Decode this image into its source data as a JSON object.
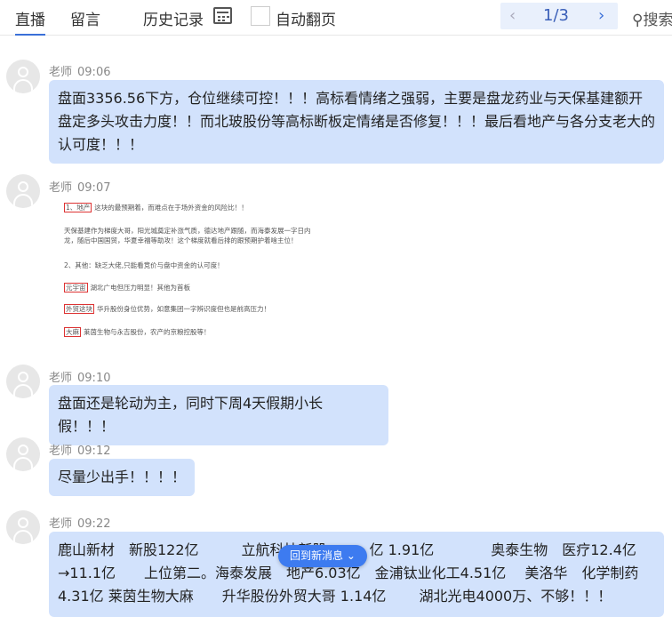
{
  "header": {
    "tabs": [
      "直播",
      "留言"
    ],
    "history": "历史记录",
    "auto_page": "自动翻页",
    "pager": {
      "prev": "‹",
      "current": "1/3",
      "next": "›"
    },
    "search": "搜索"
  },
  "messages": [
    {
      "name": "老师",
      "time": "09:06",
      "text": "盘面3356.56下方，仓位继续可控！！！高标看情绪之强弱，主要是盘龙药业与天保基建额开盘定多头攻击力度！！而北玻股份等高标断板定情绪是否修复！！！最后看地产与各分支老大的认可度！！！"
    },
    {
      "name": "老师",
      "time": "09:07",
      "image": {
        "lines": [
          {
            "tag": "1、地产",
            "text": "这块的最预期着，而难点在于场外资金的风险比！！"
          },
          {
            "tag": "",
            "text": "天保基建作为梯度大哥，阳光城奠定补涨气质，德达地产跟随，而海泰发展一字日内"
          },
          {
            "tag": "",
            "text": "龙，随后中国国贸，华夏幸福等助攻！这个梯度就看后排的跟预期护着啥主位！"
          },
          {
            "tag": "",
            "text": "2、其他：缺乏大佬,只能看竞价与盘中资金的认可度！"
          },
          {
            "tag": "元宇宙",
            "text": "湖北广电但压力明显！其他为首板"
          },
          {
            "tag": "外贸这块",
            "text": "华升股份身位优势，如意集团一字辨识度但也是前高压力！"
          },
          {
            "tag": "大麻",
            "text": "莱茵生物与永吉股份，农产的京粮控股等！"
          }
        ]
      }
    },
    {
      "name": "老师",
      "time": "09:10",
      "text": "盘面还是轮动为主，同时下周4天假期小长假！！！"
    },
    {
      "name": "老师",
      "time": "09:12",
      "text": "尽量少出手！！！！"
    },
    {
      "name": "老师",
      "time": "09:22",
      "text": "鹿山新材　新股122亿　　　立航科技新股　　　亿 1.91亿　　　　奥泰生物　医疗12.4亿→11.1亿　　上位第二。海泰发展　地产6.03亿　金浦钛业化工4.51亿　 美洛华　化学制药　 4.31亿 莱茵生物大麻　　升华股份外贸大哥 1.14亿　　 湖北光电4000万、不够！！！"
    }
  ],
  "float_button": "回到新消息"
}
